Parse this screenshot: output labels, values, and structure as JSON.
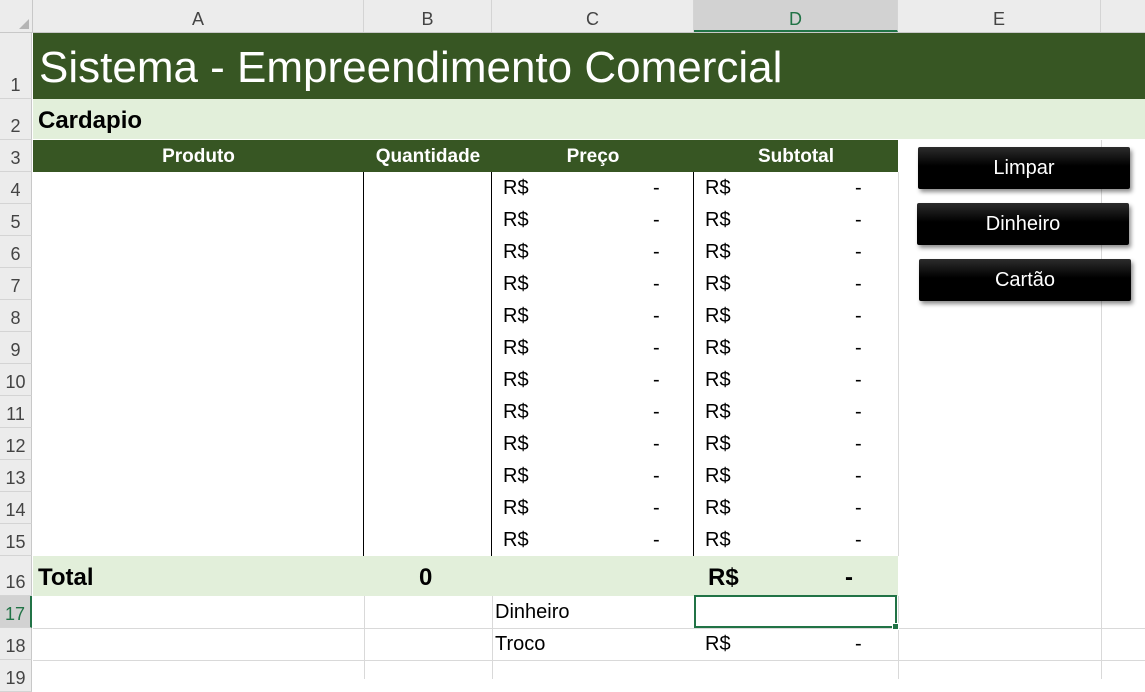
{
  "columns": [
    "A",
    "B",
    "C",
    "D",
    "E"
  ],
  "selected_column": "D",
  "rows": [
    "1",
    "2",
    "3",
    "4",
    "5",
    "6",
    "7",
    "8",
    "9",
    "10",
    "11",
    "12",
    "13",
    "14",
    "15",
    "16",
    "17",
    "18",
    "19"
  ],
  "selected_row": "17",
  "title": "Sistema - Empreendimento Comercial",
  "section": "Cardapio",
  "table": {
    "headers": [
      "Produto",
      "Quantidade",
      "Preço",
      "Subtotal"
    ],
    "currency": "R$",
    "empty_value": "-"
  },
  "total": {
    "label": "Total",
    "quantity": "0",
    "currency": "R$",
    "value": "-"
  },
  "payment": {
    "dinheiro_label": "Dinheiro",
    "troco_label": "Troco",
    "troco_currency": "R$",
    "troco_value": "-"
  },
  "buttons": {
    "limpar": "Limpar",
    "dinheiro": "Dinheiro",
    "cartao": "Cartão"
  }
}
